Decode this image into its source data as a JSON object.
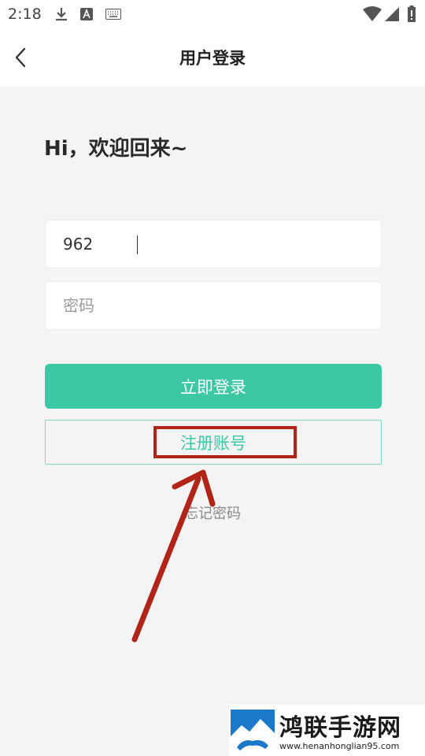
{
  "status_bar": {
    "time": "2:18",
    "icons": [
      "download-icon",
      "font-icon",
      "keyboard-icon",
      "wifi-icon",
      "signal-icon",
      "battery-icon"
    ]
  },
  "header": {
    "title": "用户登录",
    "back_icon": "chevron-left-icon"
  },
  "greeting": "Hi，欢迎回来~",
  "form": {
    "username_value": "962",
    "password_placeholder": "密码",
    "login_label": "立即登录",
    "register_label": "注册账号",
    "forgot_label": "忘记密码"
  },
  "annotation": {
    "color": "#b22418"
  },
  "watermark": {
    "title": "鸿联手游网",
    "url": "www.henanhonglian95.com"
  },
  "colors": {
    "accent": "#3dc8a4",
    "background": "#f4f4f4"
  }
}
